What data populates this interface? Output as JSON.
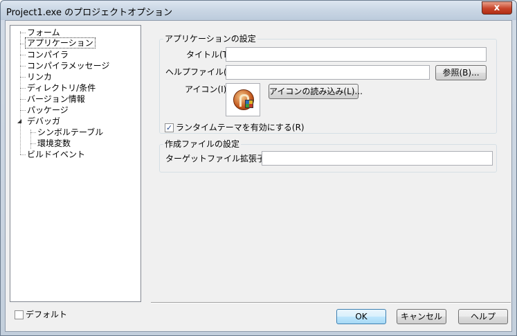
{
  "window": {
    "title": "Project1.exe のプロジェクトオプション",
    "close_label": "x"
  },
  "tree": {
    "items": [
      {
        "label": "フォーム"
      },
      {
        "label": "アプリケーション",
        "selected": true
      },
      {
        "label": "コンパイラ"
      },
      {
        "label": "コンパイラメッセージ"
      },
      {
        "label": "リンカ"
      },
      {
        "label": "ディレクトリ/条件"
      },
      {
        "label": "バージョン情報"
      },
      {
        "label": "パッケージ"
      },
      {
        "label": "デバッガ",
        "expanded": true
      },
      {
        "label": "シンボルテーブル"
      },
      {
        "label": "環境変数"
      },
      {
        "label": "ビルドイベント"
      }
    ]
  },
  "app_settings": {
    "group_label": "アプリケーションの設定",
    "title_label": "タイトル(T):",
    "title_value": "",
    "helpfile_label": "ヘルプファイル(F):",
    "helpfile_value": "",
    "browse_label": "参照(B)...",
    "icon_label": "アイコン(I):",
    "load_icon_label": "アイコンの読み込み(L)...",
    "runtime_theme_label": "ランタイムテーマを有効にする(R)",
    "runtime_theme_checked": true
  },
  "output_settings": {
    "group_label": "作成ファイルの設定",
    "ext_label": "ターゲットファイル拡張子(E):",
    "ext_value": ""
  },
  "footer": {
    "default_label": "デフォルト",
    "default_checked": false,
    "ok_label": "OK",
    "cancel_label": "キャンセル",
    "help_label": "ヘルプ"
  }
}
